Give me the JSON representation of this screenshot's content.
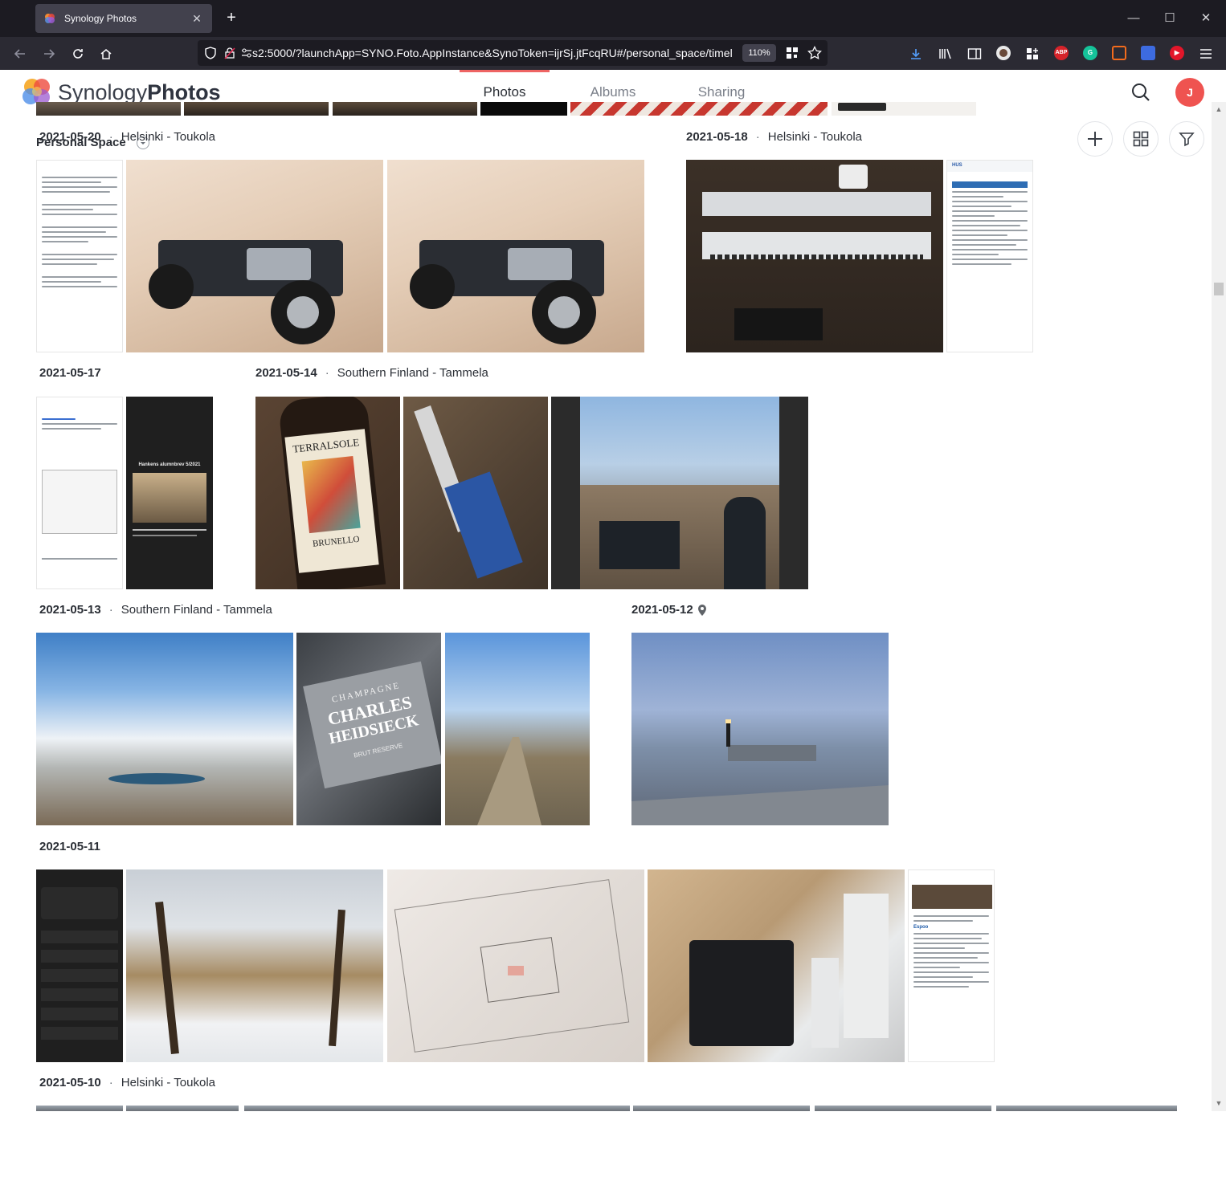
{
  "browser": {
    "tab_title": "Synology Photos",
    "url": "s2:5000/?launchApp=SYNO.Foto.AppInstance&SynoToken=ijrSj.jtFcqRU#/personal_space/timel",
    "zoom": "110%",
    "ext_abp": "ABP"
  },
  "app": {
    "logo_light": "Synology",
    "logo_bold": "Photos",
    "tabs": [
      {
        "label": "Photos",
        "active": true
      },
      {
        "label": "Albums",
        "active": false
      },
      {
        "label": "Sharing",
        "active": false
      }
    ],
    "avatar_initial": "J",
    "space_label": "Personal Space",
    "accent": "#ee6463"
  },
  "timeline": {
    "groups": [
      {
        "date": "2021-05-20",
        "location": "Helsinki - Toukola"
      },
      {
        "date": "2021-05-18",
        "location": "Helsinki - Toukola"
      },
      {
        "date": "2021-05-17",
        "location": ""
      },
      {
        "date": "2021-05-14",
        "location": "Southern Finland - Tammela"
      },
      {
        "date": "2021-05-13",
        "location": "Southern Finland - Tammela"
      },
      {
        "date": "2021-05-12",
        "location": ""
      },
      {
        "date": "2021-05-11",
        "location": ""
      },
      {
        "date": "2021-05-10",
        "location": "Helsinki - Toukola"
      }
    ],
    "labels": {
      "terralsole": "TERRALSOLE",
      "brunello": "BRUNELLO",
      "champagne": "CHAMPAGNE",
      "charles": "CHARLES",
      "heidsieck": "HEIDSIECK",
      "brut": "BRUT RESERVE",
      "hankens": "Hankens alumnbrev 5/2021",
      "hus": "HUS",
      "espoo": "Espoo"
    }
  }
}
